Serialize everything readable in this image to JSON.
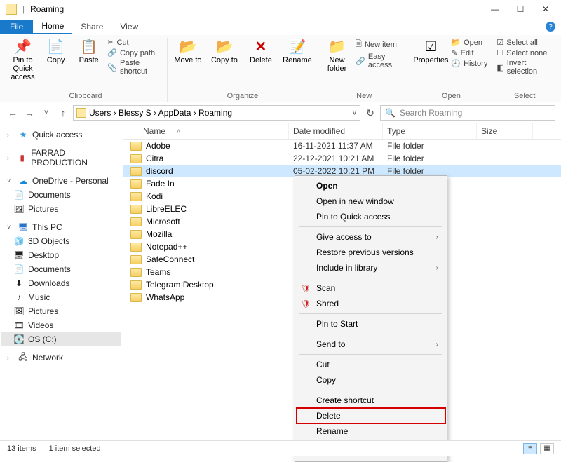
{
  "window": {
    "title": "Roaming",
    "min": "—",
    "max": "☐",
    "close": "✕"
  },
  "tabs": {
    "file": "File",
    "home": "Home",
    "share": "Share",
    "view": "View"
  },
  "ribbon": {
    "clipboard": {
      "pin": "Pin to Quick access",
      "copy": "Copy",
      "paste": "Paste",
      "cut": "Cut",
      "copypath": "Copy path",
      "shortcut": "Paste shortcut",
      "label": "Clipboard"
    },
    "organize": {
      "moveto": "Move to",
      "copyto": "Copy to",
      "delete": "Delete",
      "rename": "Rename",
      "label": "Organize"
    },
    "new": {
      "folder": "New folder",
      "newitem": "New item",
      "easy": "Easy access",
      "label": "New"
    },
    "open": {
      "props": "Properties",
      "open": "Open",
      "edit": "Edit",
      "history": "History",
      "label": "Open"
    },
    "select": {
      "all": "Select all",
      "none": "Select none",
      "invert": "Invert selection",
      "label": "Select"
    }
  },
  "breadcrumb": {
    "path": "Users › Blessy S › AppData › Roaming",
    "refresh": "↻"
  },
  "search": {
    "placeholder": "Search Roaming",
    "icon": "🔍"
  },
  "nav": {
    "quick": "Quick access",
    "farrad": "FARRAD PRODUCTION",
    "onedrive": "OneDrive - Personal",
    "docs": "Documents",
    "pics": "Pictures",
    "thispc": "This PC",
    "obj3d": "3D Objects",
    "desktop": "Desktop",
    "docs2": "Documents",
    "downloads": "Downloads",
    "music": "Music",
    "pics2": "Pictures",
    "videos": "Videos",
    "osc": "OS (C:)",
    "network": "Network"
  },
  "cols": {
    "name": "Name",
    "date": "Date modified",
    "type": "Type",
    "size": "Size"
  },
  "rows": [
    {
      "name": "Adobe",
      "date": "16-11-2021 11:37 AM",
      "type": "File folder"
    },
    {
      "name": "Citra",
      "date": "22-12-2021 10:21 AM",
      "type": "File folder"
    },
    {
      "name": "discord",
      "date": "05-02-2022 10:21 PM",
      "type": "File folder",
      "selected": true
    },
    {
      "name": "Fade In",
      "date": "",
      "type": ""
    },
    {
      "name": "Kodi",
      "date": "",
      "type": ""
    },
    {
      "name": "LibreELEC",
      "date": "",
      "type": ""
    },
    {
      "name": "Microsoft",
      "date": "",
      "type": ""
    },
    {
      "name": "Mozilla",
      "date": "",
      "type": ""
    },
    {
      "name": "Notepad++",
      "date": "",
      "type": ""
    },
    {
      "name": "SafeConnect",
      "date": "",
      "type": ""
    },
    {
      "name": "Teams",
      "date": "",
      "type": ""
    },
    {
      "name": "Telegram Desktop",
      "date": "",
      "type": ""
    },
    {
      "name": "WhatsApp",
      "date": "",
      "type": ""
    }
  ],
  "context": {
    "open": "Open",
    "opennew": "Open in new window",
    "pin": "Pin to Quick access",
    "give": "Give access to",
    "restore": "Restore previous versions",
    "include": "Include in library",
    "scan": "Scan",
    "shred": "Shred",
    "pinstart": "Pin to Start",
    "sendto": "Send to",
    "cut": "Cut",
    "copy": "Copy",
    "shortcut": "Create shortcut",
    "delete": "Delete",
    "rename": "Rename",
    "props": "Properties"
  },
  "status": {
    "count": "13 items",
    "sel": "1 item selected"
  }
}
